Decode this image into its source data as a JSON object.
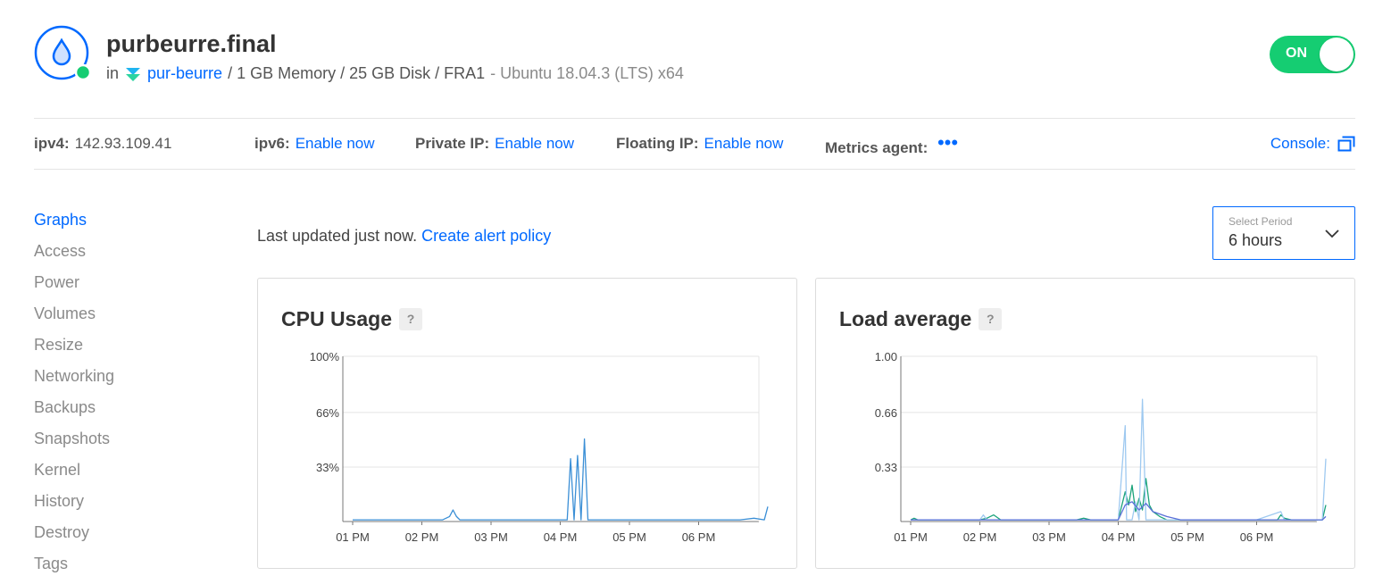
{
  "header": {
    "title": "purbeurre.final",
    "in_label": "in",
    "project_name": "pur-beurre",
    "specs": "/ 1 GB Memory / 25 GB Disk / FRA1",
    "os": "- Ubuntu 18.04.3 (LTS) x64",
    "power_label": "ON",
    "colors": {
      "status": "#15cd72",
      "accent": "#0069ff",
      "toggle": "#15cd72"
    }
  },
  "infobar": {
    "ipv4_label": "ipv4:",
    "ipv4_value": "142.93.109.41",
    "ipv6_label": "ipv6:",
    "ipv6_link": "Enable now",
    "private_ip_label": "Private IP:",
    "private_ip_link": "Enable now",
    "floating_ip_label": "Floating IP:",
    "floating_ip_link": "Enable now",
    "metrics_label": "Metrics agent:",
    "metrics_value": "•••",
    "console_label": "Console:",
    "console_icon": "external-window-icon"
  },
  "sidebar": {
    "items": [
      {
        "label": "Graphs",
        "active": true
      },
      {
        "label": "Access"
      },
      {
        "label": "Power"
      },
      {
        "label": "Volumes"
      },
      {
        "label": "Resize"
      },
      {
        "label": "Networking"
      },
      {
        "label": "Backups"
      },
      {
        "label": "Snapshots"
      },
      {
        "label": "Kernel"
      },
      {
        "label": "History"
      },
      {
        "label": "Destroy"
      },
      {
        "label": "Tags"
      }
    ]
  },
  "main": {
    "updated_text": "Last updated just now.",
    "alert_link": "Create alert policy",
    "period_caption": "Select Period",
    "period_value": "6 hours",
    "help_label": "?"
  },
  "chart_data": [
    {
      "type": "line",
      "title": "CPU Usage",
      "x_ticks": [
        "01 PM",
        "02 PM",
        "03 PM",
        "04 PM",
        "05 PM",
        "06 PM"
      ],
      "y_ticks": [
        "33%",
        "66%",
        "100%"
      ],
      "ylim": [
        0,
        100
      ],
      "grid": true,
      "series": [
        {
          "color": "#3b8fd6",
          "x": [
            0.0,
            0.5,
            1.0,
            1.3,
            1.4,
            1.45,
            1.5,
            1.55,
            1.6,
            2.0,
            2.5,
            3.0,
            3.1,
            3.15,
            3.2,
            3.25,
            3.3,
            3.35,
            3.4,
            3.45,
            3.5,
            3.6,
            4.0,
            4.5,
            5.0,
            5.5,
            5.6,
            5.8,
            5.95,
            6.0
          ],
          "y": [
            1,
            1,
            1,
            1,
            3,
            7,
            3,
            1,
            1,
            1,
            1,
            1,
            1,
            38,
            1,
            40,
            1,
            50,
            1,
            1,
            1,
            1,
            1,
            1,
            1,
            1,
            1,
            2,
            1,
            9
          ]
        }
      ]
    },
    {
      "type": "line",
      "title": "Load average",
      "x_ticks": [
        "01 PM",
        "02 PM",
        "03 PM",
        "04 PM",
        "05 PM",
        "06 PM"
      ],
      "y_ticks": [
        "0.33",
        "0.66",
        "1.00"
      ],
      "ylim": [
        0,
        1
      ],
      "grid": true,
      "series": [
        {
          "color": "#1aa37a",
          "x": [
            0.0,
            0.05,
            0.1,
            0.2,
            0.3,
            1.0,
            1.1,
            1.2,
            1.3,
            2.0,
            2.4,
            2.5,
            2.6,
            3.0,
            3.1,
            3.15,
            3.2,
            3.25,
            3.3,
            3.35,
            3.4,
            3.45,
            3.5,
            3.6,
            3.7,
            4.0,
            5.0,
            5.3,
            5.35,
            5.4,
            5.5,
            5.95,
            6.0
          ],
          "y": [
            0.01,
            0.02,
            0.01,
            0.01,
            0.01,
            0.01,
            0.02,
            0.04,
            0.01,
            0.01,
            0.01,
            0.02,
            0.01,
            0.01,
            0.18,
            0.1,
            0.22,
            0.06,
            0.14,
            0.07,
            0.26,
            0.1,
            0.06,
            0.03,
            0.01,
            0.01,
            0.01,
            0.01,
            0.04,
            0.02,
            0.01,
            0.01,
            0.1
          ]
        },
        {
          "color": "#9ec9f0",
          "x": [
            0.0,
            0.1,
            0.2,
            1.0,
            1.05,
            1.1,
            2.0,
            2.5,
            3.0,
            3.1,
            3.12,
            3.2,
            3.25,
            3.3,
            3.35,
            3.4,
            3.45,
            3.5,
            3.7,
            4.0,
            5.0,
            5.35,
            5.4,
            5.5,
            5.95,
            6.0
          ],
          "y": [
            0.01,
            0.01,
            0.01,
            0.01,
            0.04,
            0.01,
            0.01,
            0.01,
            0.01,
            0.58,
            0.01,
            0.01,
            0.12,
            0.01,
            0.74,
            0.01,
            0.01,
            0.01,
            0.01,
            0.01,
            0.01,
            0.06,
            0.01,
            0.01,
            0.01,
            0.38
          ]
        },
        {
          "color": "#5a6fd8",
          "x": [
            0.0,
            1.0,
            2.0,
            3.0,
            3.1,
            3.2,
            3.3,
            3.4,
            3.5,
            3.7,
            3.9,
            4.0,
            5.0,
            5.95,
            6.0
          ],
          "y": [
            0.01,
            0.01,
            0.01,
            0.01,
            0.1,
            0.12,
            0.07,
            0.11,
            0.06,
            0.03,
            0.01,
            0.01,
            0.01,
            0.01,
            0.03
          ]
        }
      ]
    }
  ]
}
